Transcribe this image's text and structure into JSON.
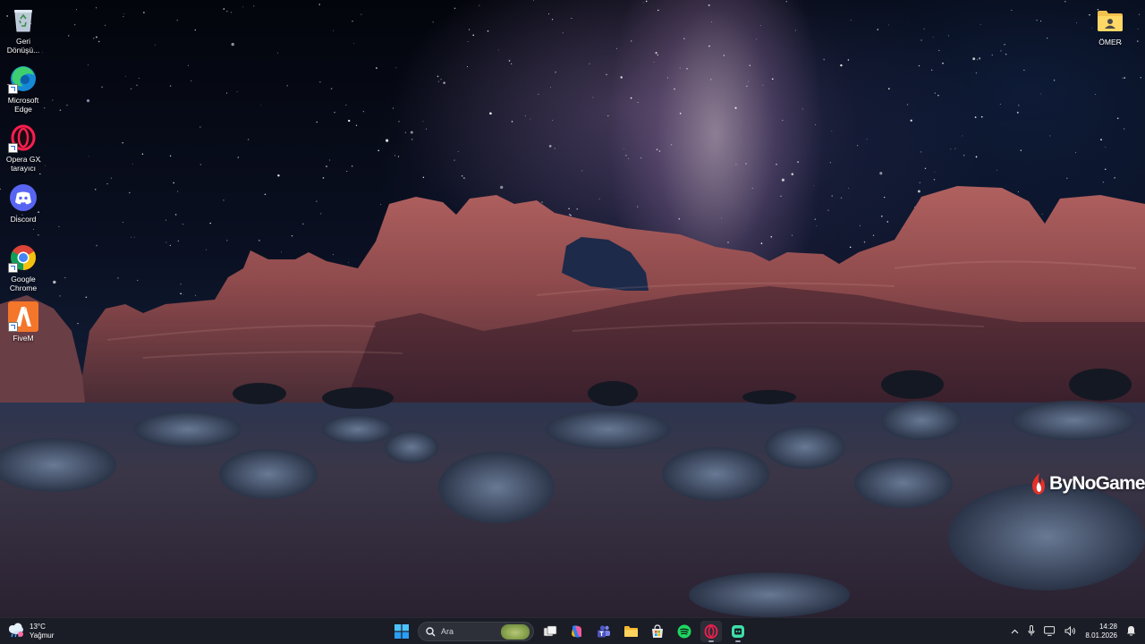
{
  "desktop_icons": [
    {
      "label": "Geri Dönüşü...",
      "icon": "recycle-bin-icon"
    },
    {
      "label": "Microsoft Edge",
      "icon": "edge-icon"
    },
    {
      "label": "Opera GX tarayıcı",
      "icon": "opera-gx-icon"
    },
    {
      "label": "Discord",
      "icon": "discord-icon"
    },
    {
      "label": "Google Chrome",
      "icon": "chrome-icon"
    },
    {
      "label": "FiveM",
      "icon": "fivem-icon"
    }
  ],
  "user_folder": {
    "label": "ÖMER",
    "icon": "user-folder-icon"
  },
  "watermark": {
    "text": "ByNoGame"
  },
  "taskbar": {
    "weather": {
      "temperature": "13°C",
      "condition": "Yağmur",
      "icon": "rain-cloud-icon"
    },
    "search": {
      "placeholder": "Ara"
    },
    "pinned": [
      {
        "name": "start",
        "icon": "windows-start-icon"
      },
      {
        "name": "task-view",
        "icon": "task-view-icon"
      },
      {
        "name": "copilot",
        "icon": "copilot-icon"
      },
      {
        "name": "teams",
        "icon": "teams-icon"
      },
      {
        "name": "file-explorer",
        "icon": "folder-icon"
      },
      {
        "name": "microsoft-store",
        "icon": "store-icon"
      },
      {
        "name": "spotify",
        "icon": "spotify-icon"
      },
      {
        "name": "opera-gx",
        "icon": "opera-gx-icon"
      },
      {
        "name": "app",
        "icon": "app-icon"
      }
    ],
    "tray": {
      "time": "14:28",
      "date": "8.01.2026"
    }
  },
  "colors": {
    "taskbar_bg": "#1a1c26",
    "accent": "#2a6fd8"
  }
}
